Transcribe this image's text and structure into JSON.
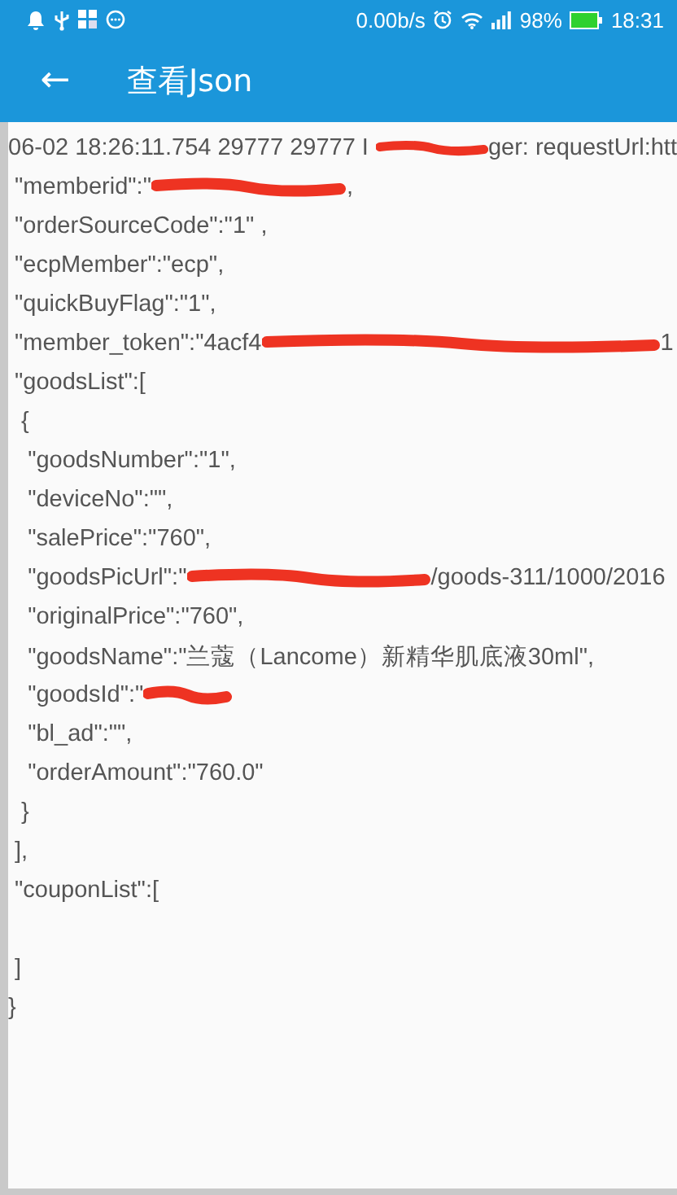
{
  "status_bar": {
    "speed": "0.00b/s",
    "battery": "98%",
    "time": "18:31"
  },
  "app_bar": {
    "back": "←",
    "title": "查看Json"
  },
  "lines": [
    {
      "kind": "text",
      "parts": [
        {
          "kind": "text",
          "text": "06-02 18:26:11.754 29777 29777 I "
        },
        {
          "kind": "redaction"
        },
        {
          "kind": "text",
          "text": "ger: requestUrl:htt"
        }
      ]
    },
    {
      "kind": "text",
      "parts": [
        {
          "kind": "text",
          "text": " \"memberid\":\""
        },
        {
          "kind": "redaction"
        },
        {
          "kind": "text",
          "text": ","
        }
      ]
    },
    {
      "kind": "text",
      "parts": [
        {
          "kind": "text",
          "text": " \"orderSourceCode\":\"1\" ,"
        }
      ]
    },
    {
      "kind": "text",
      "parts": [
        {
          "kind": "text",
          "text": " \"ecpMember\":\"ecp\","
        }
      ]
    },
    {
      "kind": "text",
      "parts": [
        {
          "kind": "text",
          "text": " \"quickBuyFlag\":\"1\","
        }
      ]
    },
    {
      "kind": "text",
      "parts": [
        {
          "kind": "text",
          "text": " \"member_token\":\"4acf4"
        },
        {
          "kind": "redaction"
        },
        {
          "kind": "text",
          "text": "1"
        }
      ]
    },
    {
      "kind": "text",
      "parts": [
        {
          "kind": "text",
          "text": " \"goodsList\":["
        }
      ]
    },
    {
      "kind": "text",
      "parts": [
        {
          "kind": "text",
          "text": "  {"
        }
      ]
    },
    {
      "kind": "text",
      "parts": [
        {
          "kind": "text",
          "text": "   \"goodsNumber\":\"1\","
        }
      ]
    },
    {
      "kind": "text",
      "parts": [
        {
          "kind": "text",
          "text": "   \"deviceNo\":\"\","
        }
      ]
    },
    {
      "kind": "text",
      "parts": [
        {
          "kind": "text",
          "text": "   \"salePrice\":\"760\","
        }
      ]
    },
    {
      "kind": "text",
      "parts": [
        {
          "kind": "text",
          "text": "   \"goodsPicUrl\":\""
        },
        {
          "kind": "redaction"
        },
        {
          "kind": "text",
          "text": "/goods-311/1000/2016"
        }
      ]
    },
    {
      "kind": "text",
      "parts": [
        {
          "kind": "text",
          "text": "   \"originalPrice\":\"760\","
        }
      ]
    },
    {
      "kind": "text",
      "parts": [
        {
          "kind": "text",
          "text": "   \"goodsName\":\"兰蔻（Lancome）新精华肌底液30ml\","
        }
      ]
    },
    {
      "kind": "text",
      "parts": [
        {
          "kind": "text",
          "text": "   \"goodsId\":\""
        },
        {
          "kind": "redaction"
        }
      ]
    },
    {
      "kind": "text",
      "parts": [
        {
          "kind": "text",
          "text": "   \"bl_ad\":\"\","
        }
      ]
    },
    {
      "kind": "text",
      "parts": [
        {
          "kind": "text",
          "text": "   \"orderAmount\":\"760.0\""
        }
      ]
    },
    {
      "kind": "text",
      "parts": [
        {
          "kind": "text",
          "text": "  }"
        }
      ]
    },
    {
      "kind": "text",
      "parts": [
        {
          "kind": "text",
          "text": " ],"
        }
      ]
    },
    {
      "kind": "text",
      "parts": [
        {
          "kind": "text",
          "text": " \"couponList\":["
        }
      ]
    },
    {
      "kind": "blank"
    },
    {
      "kind": "text",
      "parts": [
        {
          "kind": "text",
          "text": " ]"
        }
      ]
    },
    {
      "kind": "text",
      "parts": [
        {
          "kind": "text",
          "text": "}"
        }
      ]
    }
  ]
}
